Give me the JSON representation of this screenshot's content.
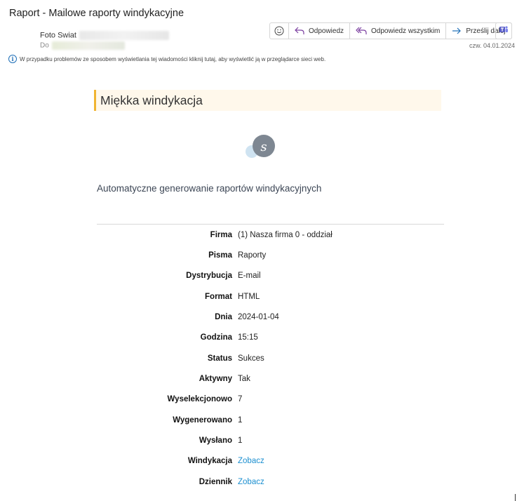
{
  "email": {
    "subject": "Raport - Mailowe raporty windykacyjne",
    "sender_name": "Foto Swiat",
    "to_label": "Do",
    "date": "czw. 04.01.2024",
    "info_text": "W przypadku problemów ze sposobem wyświetlania tej wiadomości kliknij tutaj, aby wyświetlić ją w przeglądarce sieci web."
  },
  "toolbar": {
    "emoji_icon": "smiley-icon",
    "reply_label": "Odpowiedz",
    "reply_all_label": "Odpowiedz wszystkim",
    "forward_label": "Prześlij dalej",
    "teams_icon": "teams-icon"
  },
  "body": {
    "banner_title": "Miękka windykacja",
    "tagline": "Automatyczne generowanie raportów windykacyjnych",
    "logo_letter": "s",
    "details": [
      {
        "key": "Firma",
        "value": "(1) Nasza firma 0 - oddział"
      },
      {
        "key": "Pisma",
        "value": "Raporty"
      },
      {
        "key": "Dystrybucja",
        "value": "E-mail"
      },
      {
        "key": "Format",
        "value": "HTML"
      },
      {
        "key": "Dnia",
        "value": "2024-01-04"
      },
      {
        "key": "Godzina",
        "value": "15:15"
      },
      {
        "key": "Status",
        "value": "Sukces"
      },
      {
        "key": "Aktywny",
        "value": "Tak"
      },
      {
        "key": "Wyselekcjonowo",
        "value": "7"
      },
      {
        "key": "Wygenerowano",
        "value": "1"
      },
      {
        "key": "Wysłano",
        "value": "1"
      },
      {
        "key": "Windykacja",
        "value": "Zobacz"
      },
      {
        "key": "Dziennik",
        "value": "Zobacz"
      }
    ]
  },
  "colors": {
    "accent_banner_border": "#f0b430",
    "banner_bg": "#fff8eb",
    "link": "#1b8fd0",
    "info": "#1e6fb8"
  }
}
